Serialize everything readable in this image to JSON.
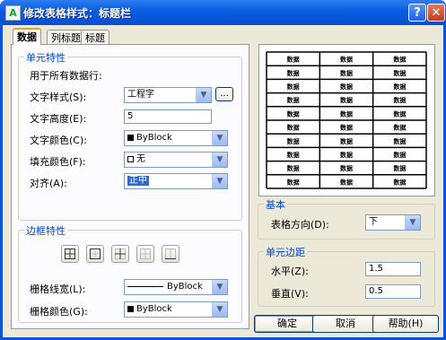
{
  "window": {
    "title": "修改表格样式：标题栏",
    "help_label": "?",
    "close_label": "✕",
    "app_icon": "A"
  },
  "tabs": [
    {
      "label": "数据",
      "active": true
    },
    {
      "label": "列标题",
      "active": false
    },
    {
      "label": "标题",
      "active": false
    }
  ],
  "cell_properties": {
    "group_title": "单元特性",
    "applies_to": "用于所有数据行:",
    "text_style": {
      "label": "文字样式(S):",
      "value": "工程字",
      "browse_label": "..."
    },
    "text_height": {
      "label": "文字高度(E):",
      "value": "5"
    },
    "text_color": {
      "label": "文字颜色(C):",
      "value": "ByBlock"
    },
    "fill_color": {
      "label": "填充颜色(F):",
      "value": "无"
    },
    "alignment": {
      "label": "对齐(A):",
      "value": "正中"
    }
  },
  "border_properties": {
    "group_title": "边框特性",
    "buttons": [
      "all-borders",
      "outside-borders",
      "inside-borders",
      "no-borders",
      "bottom-border"
    ],
    "grid_lineweight": {
      "label": "栅格线宽(L):",
      "value": "ByBlock"
    },
    "grid_color": {
      "label": "栅格颜色(G):",
      "value": "ByBlock"
    }
  },
  "preview": {
    "rows": 10,
    "cols": 3,
    "cell_text": "数据",
    "accent_color": "#0a53d6"
  },
  "basic": {
    "group_title": "基本",
    "direction": {
      "label": "表格方向(D):",
      "value": "下"
    }
  },
  "cell_margins": {
    "group_title": "单元边距",
    "horizontal": {
      "label": "水平(Z):",
      "value": "1.5"
    },
    "vertical": {
      "label": "垂直(V):",
      "value": "0.5"
    }
  },
  "footer": {
    "ok_label": "确定",
    "cancel_label": "取消",
    "help_label": "帮助(H)"
  }
}
